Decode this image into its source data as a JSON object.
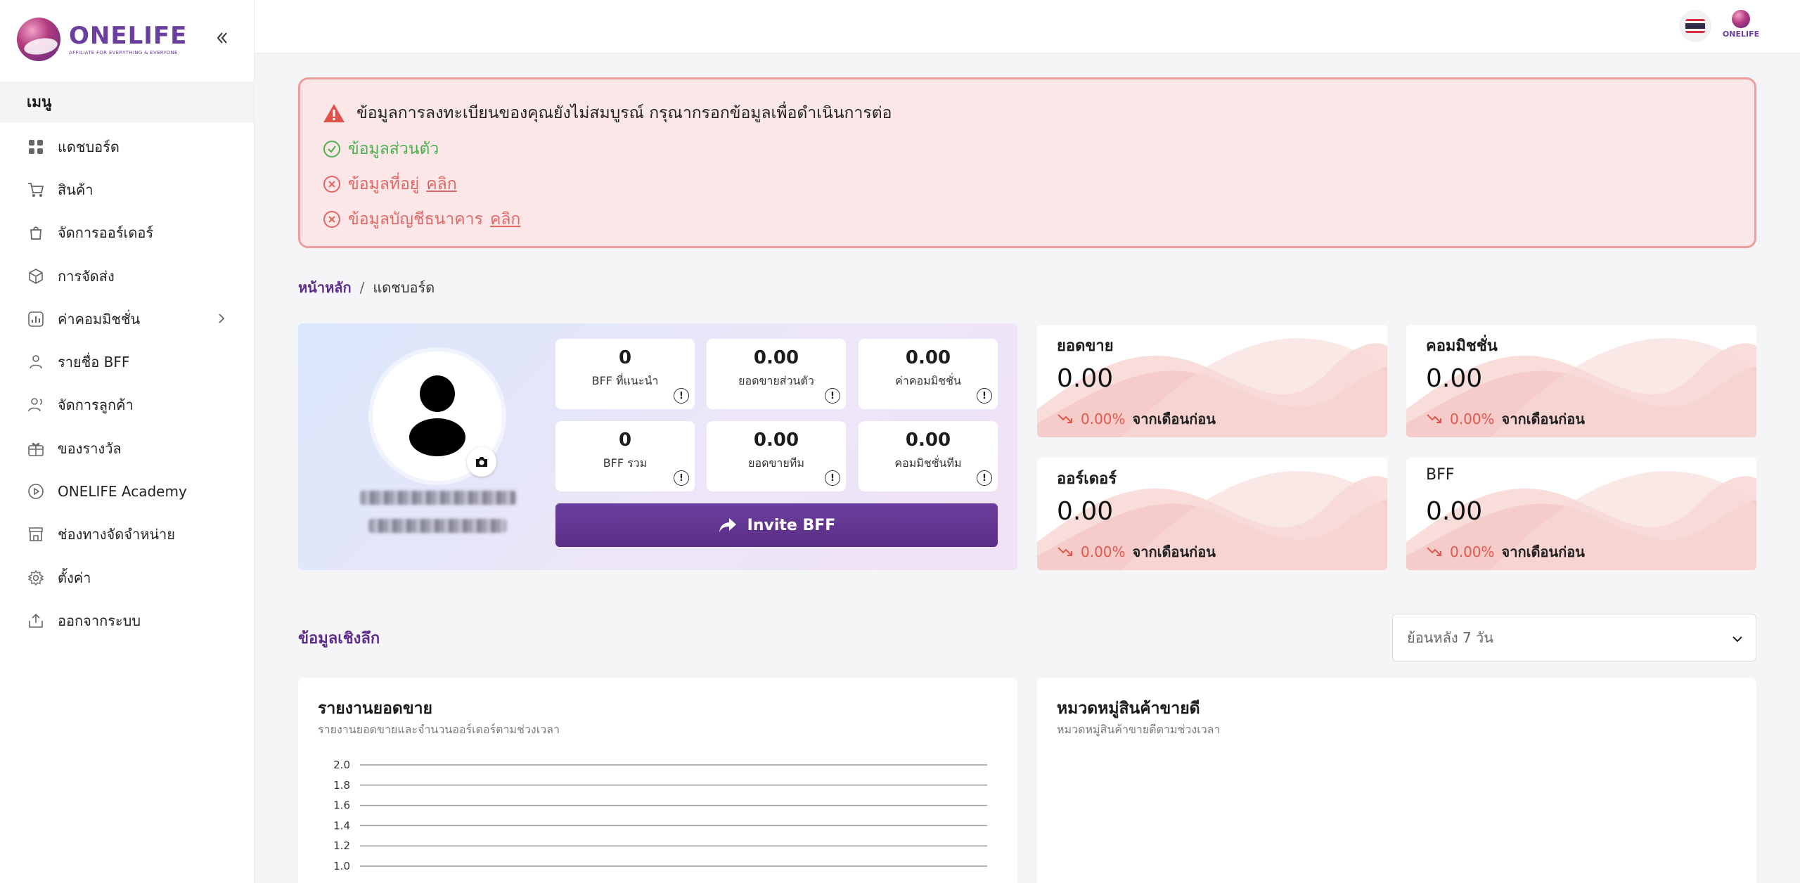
{
  "brand": {
    "name": "ONELIFE",
    "tagline": "AFFILIATE FOR EVERYTHING & EVERYONE"
  },
  "sidebar": {
    "menu_header": "เมนู",
    "items": [
      {
        "label": "แดชบอร์ด",
        "icon": "grid-icon"
      },
      {
        "label": "สินค้า",
        "icon": "cart-icon"
      },
      {
        "label": "จัดการออร์เดอร์",
        "icon": "bag-icon"
      },
      {
        "label": "การจัดส่ง",
        "icon": "box-icon"
      },
      {
        "label": "ค่าคอมมิชชั่น",
        "icon": "chart-icon"
      },
      {
        "label": "รายชื่อ BFF",
        "icon": "users-icon"
      },
      {
        "label": "จัดการลูกค้า",
        "icon": "user-icon"
      },
      {
        "label": "ของรางวัล",
        "icon": "gift-icon"
      },
      {
        "label": "ONELIFE Academy",
        "icon": "play-icon"
      },
      {
        "label": "ช่องทางจัดจำหน่าย",
        "icon": "store-icon"
      },
      {
        "label": "ตั้งค่า",
        "icon": "gear-icon"
      },
      {
        "label": "ออกจากระบบ",
        "icon": "logout-icon"
      }
    ]
  },
  "topbar": {
    "mini_logo": "ONELIFE"
  },
  "alert": {
    "title": "ข้อมูลการลงทะเบียนของคุณยังไม่สมบูรณ์ กรุณากรอกข้อมูลเพื่อดำเนินการต่อ",
    "personal": "ข้อมูลส่วนตัว",
    "address": "ข้อมูลที่อยู่",
    "bank": "ข้อมูลบัญชีธนาคาร",
    "click": "คลิก"
  },
  "breadcrumb": {
    "home": "หน้าหลัก",
    "separator": "/",
    "current": "แดชบอร์ด"
  },
  "profile": {
    "stats": [
      {
        "value": "0",
        "label": "BFF ที่แนะนำ"
      },
      {
        "value": "0.00",
        "label": "ยอดขายส่วนตัว"
      },
      {
        "value": "0.00",
        "label": "ค่าคอมมิชชั่น"
      },
      {
        "value": "0",
        "label": "BFF รวม"
      },
      {
        "value": "0.00",
        "label": "ยอดขายทีม"
      },
      {
        "value": "0.00",
        "label": "คอมมิชชั่นทีม"
      }
    ],
    "info_glyph": "!",
    "invite_label": "Invite BFF"
  },
  "kpis": [
    {
      "title": "ยอดขาย",
      "amount": "0.00",
      "pct": "0.00%",
      "delta_text": "จากเดือนก่อน"
    },
    {
      "title": "คอมมิชชั่น",
      "amount": "0.00",
      "pct": "0.00%",
      "delta_text": "จากเดือนก่อน"
    },
    {
      "title": "ออร์เดอร์",
      "amount": "0.00",
      "pct": "0.00%",
      "delta_text": "จากเดือนก่อน"
    },
    {
      "title": "BFF",
      "amount": "0.00",
      "pct": "0.00%",
      "delta_text": "จากเดือนก่อน"
    }
  ],
  "insights": {
    "title": "ข้อมูลเชิงลึก",
    "range_selected": "ย้อนหลัง 7 วัน",
    "sales_card": {
      "title": "รายงานยอดขาย",
      "subtitle": "รายงานยอดขายและจำนวนออร์เดอร์ตามช่วงเวลา"
    },
    "category_card": {
      "title": "หมวดหมู่สินค้าขายดี",
      "subtitle": "หมวดหมู่สินค้าขายดีตามช่วงเวลา"
    }
  },
  "chart_data": {
    "type": "line",
    "title": "",
    "y_ticks": [
      "2.0",
      "1.8",
      "1.6",
      "1.4",
      "1.2",
      "1.0"
    ],
    "ylim": [
      1.0,
      2.0
    ],
    "grid": true,
    "series": []
  },
  "colors": {
    "accent": "#5e2d8a",
    "alert_bg": "#fbe7e7",
    "alert_border": "#ec9d9d",
    "success": "#4caf50",
    "danger": "#e06666",
    "trend_down": "#e2574c"
  }
}
